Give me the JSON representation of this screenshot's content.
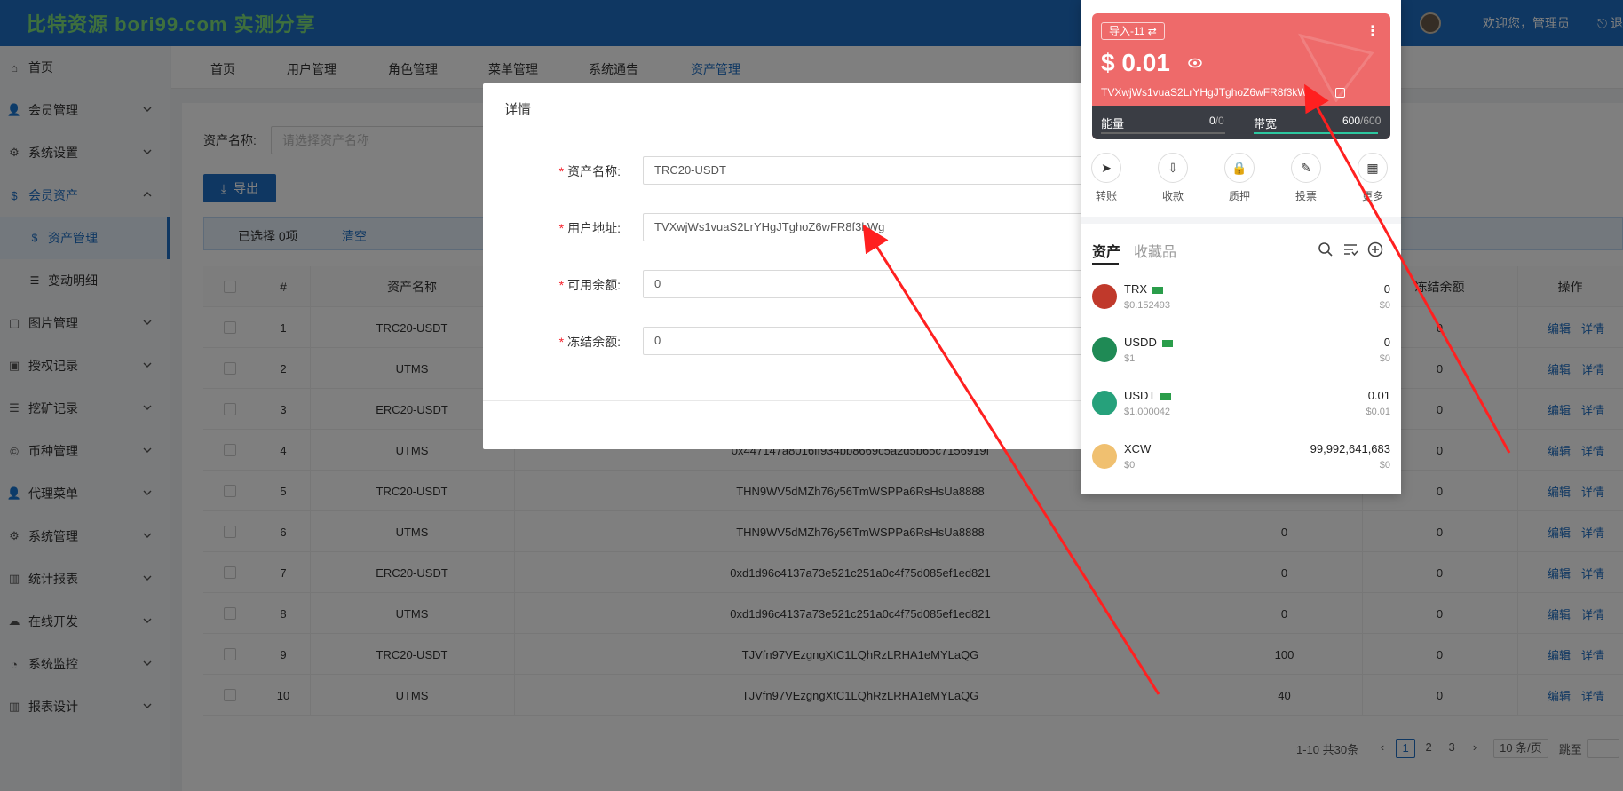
{
  "header": {
    "logo_text": "比特资源 bori99.com 实测分享",
    "welcome": "欢迎您，管理员",
    "logout": "退"
  },
  "sidebar": {
    "items": [
      {
        "label": "首页",
        "icon": "home-icon"
      },
      {
        "label": "会员管理",
        "icon": "user-icon"
      },
      {
        "label": "系统设置",
        "icon": "gear-icon"
      },
      {
        "label": "会员资产",
        "icon": "coin-icon"
      },
      {
        "label": "图片管理",
        "icon": "image-icon"
      },
      {
        "label": "授权记录",
        "icon": "picture-icon"
      },
      {
        "label": "挖矿记录",
        "icon": "list-icon"
      },
      {
        "label": "币种管理",
        "icon": "currency-icon"
      },
      {
        "label": "代理菜单",
        "icon": "user-icon"
      },
      {
        "label": "系统管理",
        "icon": "gear-icon"
      },
      {
        "label": "统计报表",
        "icon": "chart-icon"
      },
      {
        "label": "在线开发",
        "icon": "cloud-icon"
      },
      {
        "label": "系统监控",
        "icon": "gauge-icon"
      },
      {
        "label": "报表设计",
        "icon": "chart-icon"
      }
    ],
    "sub_items": [
      {
        "label": "资产管理"
      },
      {
        "label": "变动明细"
      }
    ]
  },
  "tabs": [
    "首页",
    "用户管理",
    "角色管理",
    "菜单管理",
    "系统通告",
    "资产管理"
  ],
  "filter": {
    "label": "资产名称:",
    "placeholder": "请选择资产名称",
    "export_label": "导出"
  },
  "selection": {
    "text": "已选择 0项",
    "clear": "清空"
  },
  "table": {
    "headers": [
      "#",
      "资产名称",
      "冻结余额",
      "操作"
    ],
    "rows": [
      {
        "no": "1",
        "name": "TRC20-USDT",
        "address": "",
        "available": "",
        "frozen": "0"
      },
      {
        "no": "2",
        "name": "UTMS",
        "address": "",
        "available": "",
        "frozen": "0"
      },
      {
        "no": "3",
        "name": "ERC20-USDT",
        "address": "",
        "available": "",
        "frozen": "0"
      },
      {
        "no": "4",
        "name": "UTMS",
        "address": "0x447147a8016ff934bb8669c5a2d5b65c7156919f",
        "available": "",
        "frozen": "0"
      },
      {
        "no": "5",
        "name": "TRC20-USDT",
        "address": "THN9WV5dMZh76y56TmWSPPa6RsHsUa8888",
        "available": "",
        "frozen": "0"
      },
      {
        "no": "6",
        "name": "UTMS",
        "address": "THN9WV5dMZh76y56TmWSPPa6RsHsUa8888",
        "available": "0",
        "frozen": "0"
      },
      {
        "no": "7",
        "name": "ERC20-USDT",
        "address": "0xd1d96c4137a73e521c251a0c4f75d085ef1ed821",
        "available": "0",
        "frozen": "0"
      },
      {
        "no": "8",
        "name": "UTMS",
        "address": "0xd1d96c4137a73e521c251a0c4f75d085ef1ed821",
        "available": "0",
        "frozen": "0"
      },
      {
        "no": "9",
        "name": "TRC20-USDT",
        "address": "TJVfn97VEzgngXtC1LQhRzLRHA1eMYLaQG",
        "available": "100",
        "frozen": "0"
      },
      {
        "no": "10",
        "name": "UTMS",
        "address": "TJVfn97VEzgngXtC1LQhRzLRHA1eMYLaQG",
        "available": "40",
        "frozen": "0"
      }
    ],
    "edit_label": "编辑",
    "detail_label": "详情"
  },
  "pagination": {
    "total": "1-10 共30条",
    "pages": [
      "1",
      "2",
      "3"
    ],
    "page_size": "10 条/页",
    "jump": "跳至"
  },
  "dialog": {
    "title": "详情",
    "fields": [
      {
        "label": "资产名称:",
        "value": "TRC20-USDT"
      },
      {
        "label": "用户地址:",
        "value": "TVXwjWs1vuaS2LrYHgJTghoZ6wFR8f3kWg"
      },
      {
        "label": "可用余额:",
        "value": "0"
      },
      {
        "label": "冻结余额:",
        "value": "0"
      }
    ]
  },
  "wallet": {
    "tag": "导入-11 ⇄",
    "balance": "$ 0.01",
    "address": "TVXwjWs1vuaS2LrYHgJTghoZ6wFR8f3kWg",
    "energy_label": "能量",
    "energy_used": "0",
    "energy_total": "/0",
    "bandwidth_label": "带宽",
    "bandwidth_used": "600",
    "bandwidth_total": "/600",
    "bandwidth_fill": 1.0,
    "energy_fill": 0,
    "actions": [
      "转账",
      "收款",
      "质押",
      "投票",
      "更多"
    ],
    "tab_assets": "资产",
    "tab_collectibles": "收藏品",
    "assets": [
      {
        "name": "TRX",
        "price": "$0.152493",
        "amount": "0",
        "value": "$0",
        "color": "#c0392b"
      },
      {
        "name": "USDD",
        "price": "$1",
        "amount": "0",
        "value": "$0",
        "color": "#1f8a55"
      },
      {
        "name": "USDT",
        "price": "$1.000042",
        "amount": "0.01",
        "value": "$0.01",
        "color": "#26a17b"
      },
      {
        "name": "XCW",
        "price": "$0",
        "amount": "99,992,641,683",
        "value": "$0",
        "color": "#f0c070"
      }
    ]
  },
  "colors": {
    "primary": "#1e6fc4",
    "wallet_card": "#ee6a6a",
    "annotation": "#ff2020"
  }
}
